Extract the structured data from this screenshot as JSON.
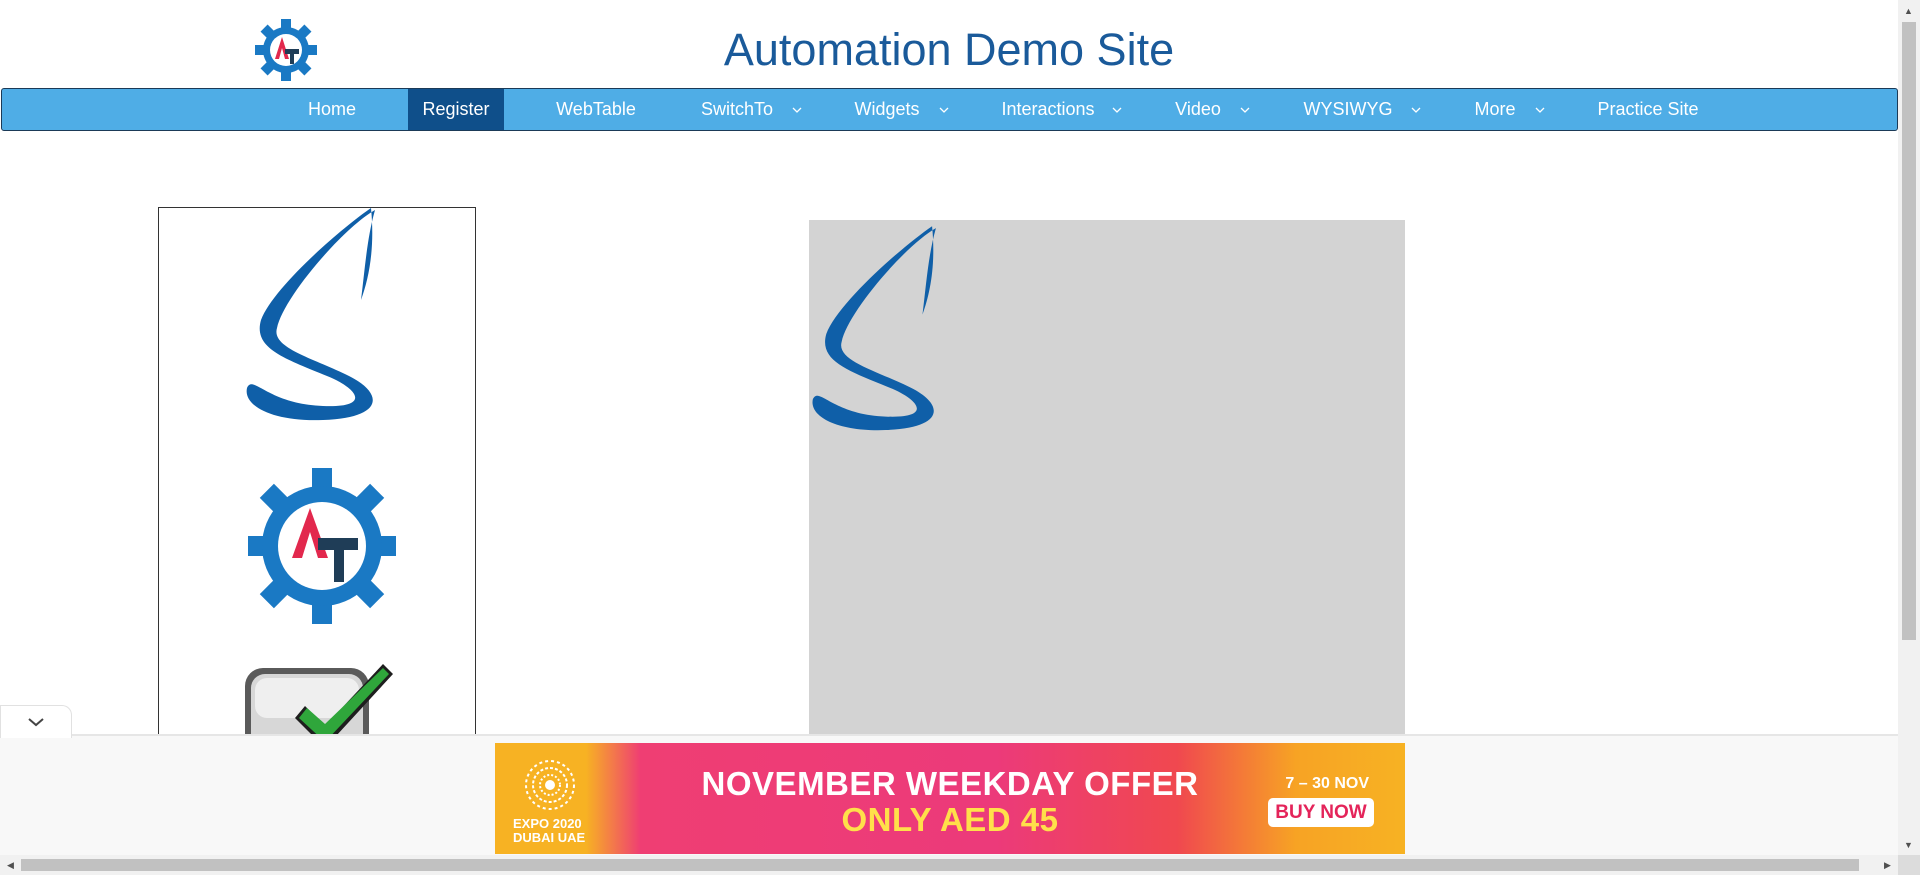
{
  "header": {
    "title": "Automation Demo Site",
    "logo_icon": "automation-testing-gear-logo"
  },
  "nav": {
    "items": [
      {
        "label": "Home",
        "dropdown": false,
        "active": false
      },
      {
        "label": "Register",
        "dropdown": false,
        "active": true
      },
      {
        "label": "WebTable",
        "dropdown": false,
        "active": false
      },
      {
        "label": "SwitchTo",
        "dropdown": true,
        "active": false
      },
      {
        "label": "Widgets",
        "dropdown": true,
        "active": false
      },
      {
        "label": "Interactions",
        "dropdown": true,
        "active": false
      },
      {
        "label": "Video",
        "dropdown": true,
        "active": false
      },
      {
        "label": "WYSIWYG",
        "dropdown": true,
        "active": false
      },
      {
        "label": "More",
        "dropdown": true,
        "active": false
      },
      {
        "label": "Practice Site",
        "dropdown": false,
        "active": false
      }
    ],
    "background": "#4fade6",
    "active_background": "#0f4f8a"
  },
  "drag_source": {
    "items": [
      "selenium-logo",
      "automation-testing-logo",
      "test-complete-logo"
    ]
  },
  "drop_target": {
    "items": [
      "selenium-logo"
    ],
    "background": "#d3d3d3"
  },
  "ad": {
    "line1": "NOVEMBER WEEKDAY OFFER",
    "line2": "ONLY AED 45",
    "dates": "7 – 30 NOV",
    "cta": "BUY NOW",
    "expo_line1": "EXPO 2020",
    "expo_line2": "DUBAI UAE"
  }
}
